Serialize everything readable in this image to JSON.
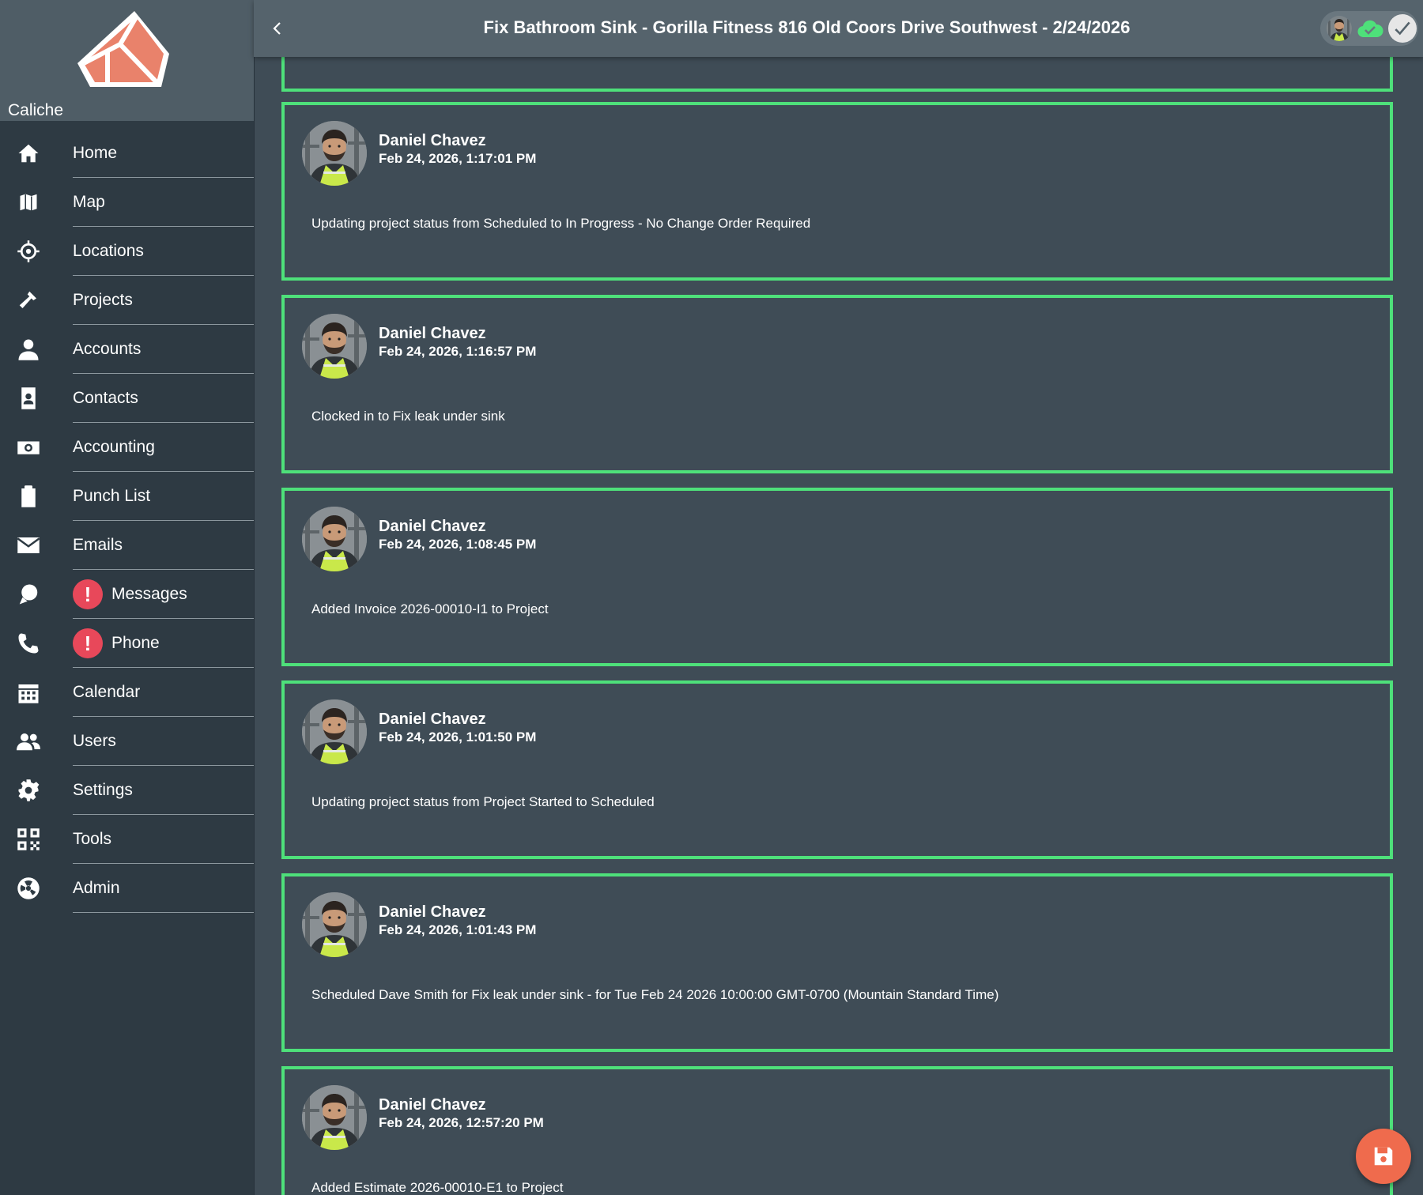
{
  "brand": {
    "name": "Caliche",
    "logo_icon": "caliche-cube-logo",
    "logo_color": "#e9826b"
  },
  "header": {
    "title": "Fix Bathroom Sink - Gorilla Fitness 816 Old Coors Drive Southwest - 2/24/2026",
    "back_icon": "chevron-left-icon",
    "sync_icon": "cloud-check-icon",
    "sync_color": "#4ee07a",
    "check_icon": "checkmark-icon"
  },
  "sidebar": {
    "items": [
      {
        "label": "Home",
        "icon": "home-icon",
        "alert": false
      },
      {
        "label": "Map",
        "icon": "map-icon",
        "alert": false
      },
      {
        "label": "Locations",
        "icon": "crosshair-icon",
        "alert": false
      },
      {
        "label": "Projects",
        "icon": "hammer-icon",
        "alert": false
      },
      {
        "label": "Accounts",
        "icon": "user-icon",
        "alert": false
      },
      {
        "label": "Contacts",
        "icon": "contact-card-icon",
        "alert": false
      },
      {
        "label": "Accounting",
        "icon": "money-icon",
        "alert": false
      },
      {
        "label": "Punch List",
        "icon": "clipboard-icon",
        "alert": false
      },
      {
        "label": "Emails",
        "icon": "envelope-icon",
        "alert": false
      },
      {
        "label": "Messages",
        "icon": "chat-icon",
        "alert": true
      },
      {
        "label": "Phone",
        "icon": "phone-icon",
        "alert": true
      },
      {
        "label": "Calendar",
        "icon": "calendar-icon",
        "alert": false
      },
      {
        "label": "Users",
        "icon": "users-icon",
        "alert": false
      },
      {
        "label": "Settings",
        "icon": "gear-icon",
        "alert": false
      },
      {
        "label": "Tools",
        "icon": "qr-code-icon",
        "alert": false
      },
      {
        "label": "Admin",
        "icon": "admin-icon",
        "alert": false
      }
    ],
    "alert_glyph": "!",
    "alert_color": "#e8485a"
  },
  "feed": {
    "accent_color": "#4ee07a",
    "entries": [
      {
        "author": "Daniel Chavez",
        "timestamp": "Feb 24, 2026, 1:17:01 PM",
        "message": "Updating project status from Scheduled to In Progress - No Change Order Required"
      },
      {
        "author": "Daniel Chavez",
        "timestamp": "Feb 24, 2026, 1:16:57 PM",
        "message": "Clocked in to Fix leak under sink"
      },
      {
        "author": "Daniel Chavez",
        "timestamp": "Feb 24, 2026, 1:08:45 PM",
        "message": "Added Invoice 2026-00010-I1 to Project"
      },
      {
        "author": "Daniel Chavez",
        "timestamp": "Feb 24, 2026, 1:01:50 PM",
        "message": "Updating project status from Project Started to Scheduled"
      },
      {
        "author": "Daniel Chavez",
        "timestamp": "Feb 24, 2026, 1:01:43 PM",
        "message": "Scheduled Dave Smith for Fix leak under sink - for Tue Feb 24 2026 10:00:00 GMT-0700 (Mountain Standard Time)"
      },
      {
        "author": "Daniel Chavez",
        "timestamp": "Feb 24, 2026, 12:57:20 PM",
        "message": "Added Estimate 2026-00010-E1 to Project"
      }
    ]
  },
  "fab": {
    "icon": "save-icon",
    "color": "#ef6b4d"
  }
}
